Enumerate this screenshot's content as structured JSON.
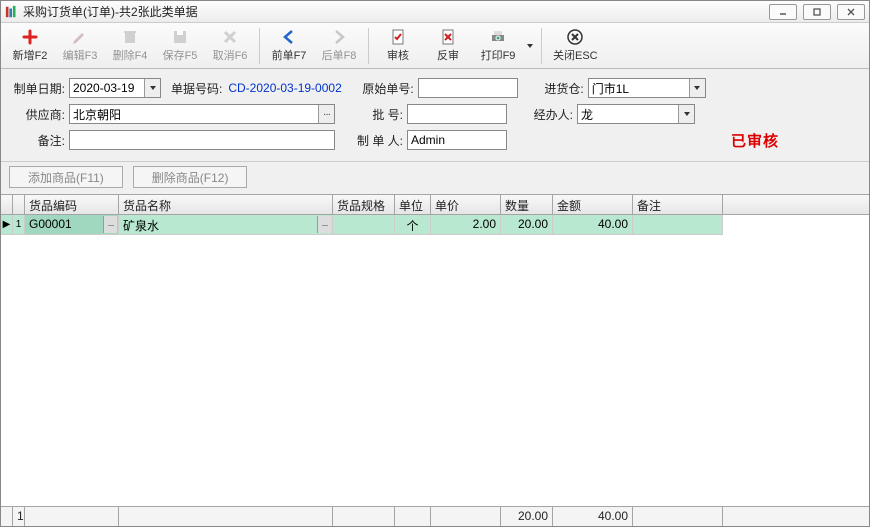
{
  "window": {
    "title": "采购订货单(订单)-共2张此类单据"
  },
  "toolbar": {
    "new": "新增F2",
    "edit": "编辑F3",
    "delete": "删除F4",
    "save": "保存F5",
    "cancel": "取消F6",
    "prev": "前单F7",
    "next": "后单F8",
    "audit": "审核",
    "unaudit": "反审",
    "print": "打印F9",
    "close": "关闭ESC"
  },
  "form": {
    "date_label": "制单日期:",
    "date_value": "2020-03-19",
    "billno_label": "单据号码:",
    "billno_value": "CD-2020-03-19-0002",
    "orig_label": "原始单号:",
    "orig_value": "",
    "wh_label": "进货仓:",
    "wh_value": "门市1L",
    "supplier_label": "供应商:",
    "supplier_value": "北京朝阳",
    "batch_label": "批    号:",
    "batch_value": "",
    "handler_label": "经办人:",
    "handler_value": "龙",
    "remark_label": "备注:",
    "remark_value": "",
    "maker_label": "制 单 人:",
    "maker_value": "Admin",
    "stamp": "已审核"
  },
  "buttons": {
    "add_item": "添加商品(F11)",
    "del_item": "删除商品(F12)"
  },
  "grid": {
    "headers": {
      "code": "货品编码",
      "name": "货品名称",
      "spec": "货品规格",
      "unit": "单位",
      "price": "单价",
      "qty": "数量",
      "amt": "金额",
      "note": "备注"
    },
    "rows": [
      {
        "rn": "1",
        "code": "G00001",
        "name": "矿泉水",
        "spec": "",
        "unit": "个",
        "price": "2.00",
        "qty": "20.00",
        "amt": "40.00",
        "note": ""
      }
    ],
    "footer": {
      "count": "1",
      "qty": "20.00",
      "amt": "40.00"
    }
  }
}
